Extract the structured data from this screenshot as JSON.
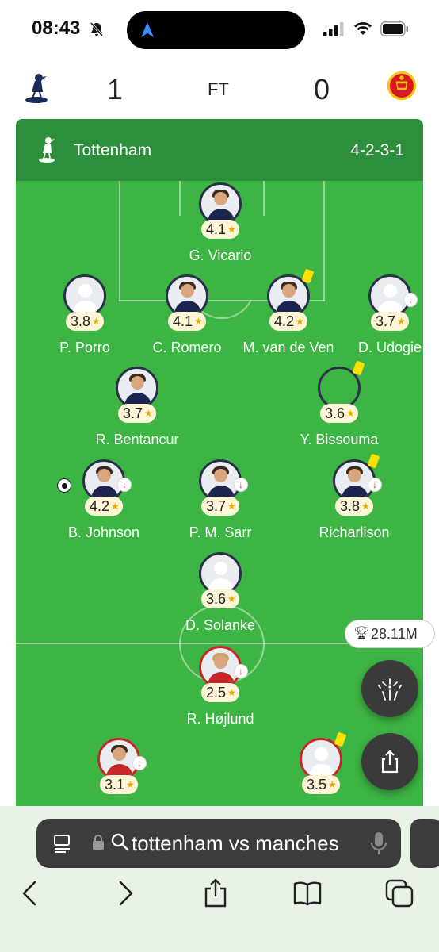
{
  "status_bar": {
    "time": "08:43"
  },
  "match": {
    "home_score": "1",
    "status": "FT",
    "away_score": "0"
  },
  "lineup": {
    "team": "Tottenham",
    "formation": "4-2-3-1"
  },
  "players": [
    {
      "name": "G. Vicario",
      "rating": "4.1"
    },
    {
      "name": "P. Porro",
      "rating": "3.8"
    },
    {
      "name": "C. Romero",
      "rating": "4.1"
    },
    {
      "name": "M. van de Ven",
      "rating": "4.2"
    },
    {
      "name": "D. Udogie",
      "rating": "3.7"
    },
    {
      "name": "R. Bentancur",
      "rating": "3.7"
    },
    {
      "name": "Y. Bissouma",
      "rating": "3.6"
    },
    {
      "name": "B. Johnson",
      "rating": "4.2"
    },
    {
      "name": "P. M. Sarr",
      "rating": "3.7"
    },
    {
      "name": "Richarlison",
      "rating": "3.8"
    },
    {
      "name": "D. Solanke",
      "rating": "3.6"
    },
    {
      "name": "R. Højlund",
      "rating": "2.5"
    },
    {
      "name": "",
      "rating": "3.1"
    },
    {
      "name": "",
      "rating": "3.5"
    }
  ],
  "votes_badge": "28.11M",
  "browser": {
    "url": "tottenham vs manches"
  },
  "colors": {
    "pitch": "#3db544",
    "header": "#2d8f3c",
    "rating_bg": "#fff6d8",
    "star": "#e9a800",
    "yellow_card": "#ffe000",
    "sub_arrow": "#d32f2f"
  }
}
